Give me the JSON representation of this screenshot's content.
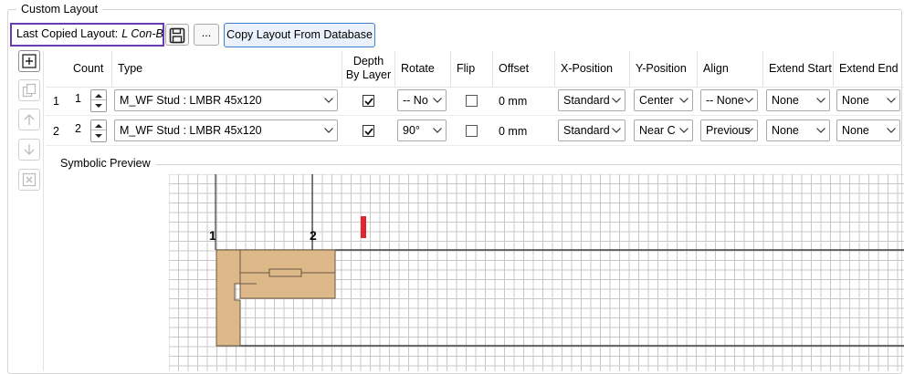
{
  "group": {
    "title": "Custom Layout"
  },
  "toolbar": {
    "last_copied_label": "Last Copied Layout:",
    "last_copied_value": "L Con-B",
    "save_icon": "save-icon",
    "dots_label": "...",
    "copy_button_label": "Copy Layout From Database"
  },
  "side_buttons": [
    {
      "name": "add-row-icon",
      "enabled": true
    },
    {
      "name": "duplicate-row-icon",
      "enabled": false
    },
    {
      "name": "move-up-icon",
      "enabled": false
    },
    {
      "name": "move-down-icon",
      "enabled": false
    },
    {
      "name": "delete-row-icon",
      "enabled": false
    }
  ],
  "table": {
    "headers": {
      "count": "Count",
      "type": "Type",
      "depth_line1": "Depth",
      "depth_line2": "By Layer",
      "rotate": "Rotate",
      "flip": "Flip",
      "offset": "Offset",
      "xpos": "X-Position",
      "ypos": "Y-Position",
      "align": "Align",
      "ext_start": "Extend Start",
      "ext_end": "Extend End"
    },
    "rows": [
      {
        "num": "1",
        "count": "1",
        "type": "M_WF Stud : LMBR 45x120",
        "depth_by_layer": true,
        "rotate": "-- No",
        "flip": false,
        "offset": "0 mm",
        "xpos": "Standard",
        "ypos": "Center",
        "align": "-- None",
        "ext_start": "None",
        "ext_end": "None"
      },
      {
        "num": "2",
        "count": "2",
        "type": "M_WF Stud : LMBR 45x120",
        "depth_by_layer": true,
        "rotate": "90°",
        "flip": false,
        "offset": "0 mm",
        "xpos": "Standard",
        "ypos": "Near C",
        "align": "Previous",
        "ext_start": "None",
        "ext_end": "None"
      }
    ]
  },
  "preview": {
    "title": "Symbolic Preview",
    "markers": [
      "1",
      "2"
    ],
    "colors": {
      "member_fill": "#ddb98a",
      "member_stroke": "#6b5640",
      "indicator": "#e0262e",
      "grid": "#c8c8c8"
    }
  },
  "colors": {
    "highlight_border": "#6a3bb6",
    "primary_button_border": "#3d7fd1"
  }
}
